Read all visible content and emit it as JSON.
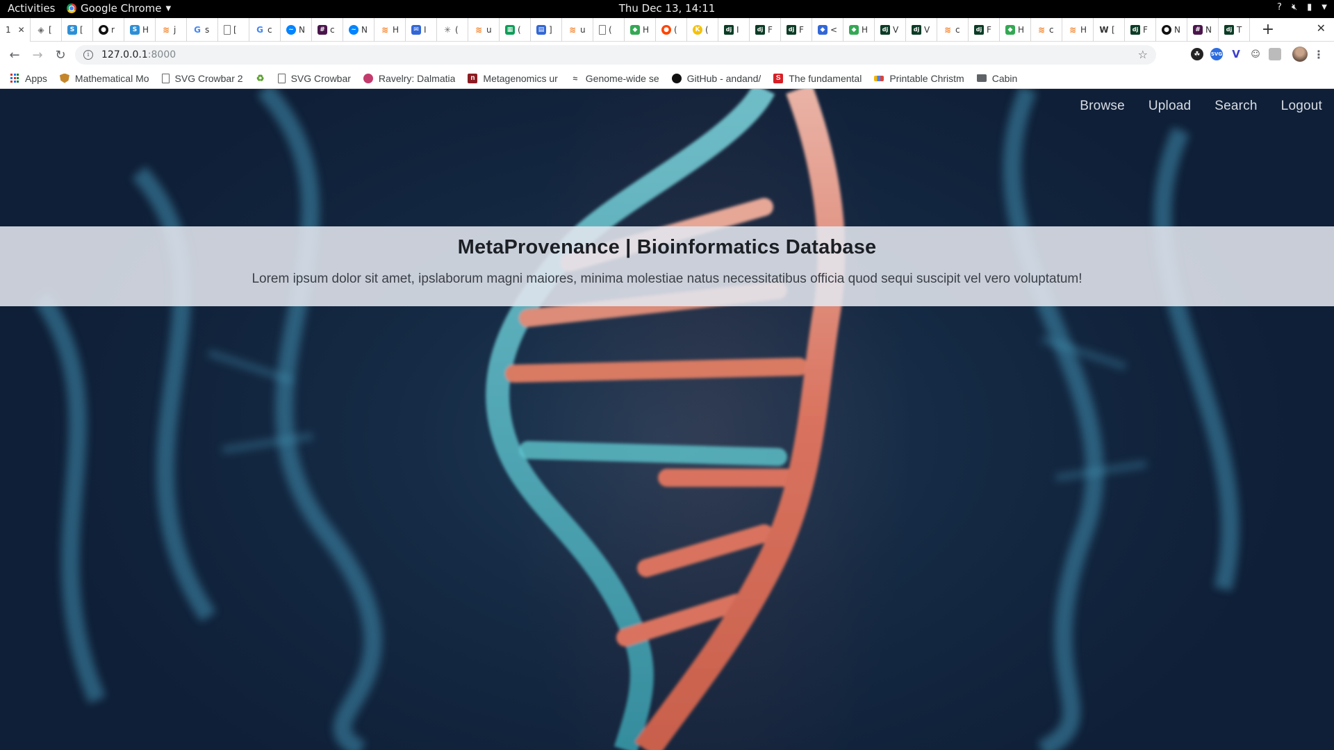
{
  "system_bar": {
    "activities": "Activities",
    "app_name": "Google Chrome",
    "clock": "Thu Dec 13, 14:11"
  },
  "browser": {
    "active_tab_title": "1",
    "tabs": [
      {
        "icon": "compass-icon",
        "letter": "["
      },
      {
        "icon": "scholar-icon",
        "letter": "["
      },
      {
        "icon": "github-icon",
        "letter": "r"
      },
      {
        "icon": "scholar-icon",
        "letter": "H"
      },
      {
        "icon": "stackoverflow-icon",
        "letter": "j"
      },
      {
        "icon": "google-icon",
        "letter": "s"
      },
      {
        "icon": "document-icon",
        "letter": "["
      },
      {
        "icon": "google-icon",
        "letter": "c"
      },
      {
        "icon": "messenger-icon",
        "letter": "N"
      },
      {
        "icon": "slack-icon",
        "letter": "c"
      },
      {
        "icon": "messenger-icon",
        "letter": "N"
      },
      {
        "icon": "stackoverflow-icon",
        "letter": "H"
      },
      {
        "icon": "mail-icon",
        "letter": "I"
      },
      {
        "icon": "asterisk-icon",
        "letter": "("
      },
      {
        "icon": "stackoverflow-icon",
        "letter": "u"
      },
      {
        "icon": "sheets-icon",
        "letter": "("
      },
      {
        "icon": "calendar-icon",
        "letter": "]"
      },
      {
        "icon": "stackoverflow-icon",
        "letter": "u"
      },
      {
        "icon": "document-icon",
        "letter": "("
      },
      {
        "icon": "green-app-icon",
        "letter": "H"
      },
      {
        "icon": "reddit-icon",
        "letter": "("
      },
      {
        "icon": "yellow-app-icon",
        "letter": "("
      },
      {
        "icon": "django-icon",
        "letter": "I"
      },
      {
        "icon": "django-icon",
        "letter": "F"
      },
      {
        "icon": "django-icon",
        "letter": "F"
      },
      {
        "icon": "blue-app-icon",
        "letter": "<"
      },
      {
        "icon": "green-app-icon",
        "letter": "H"
      },
      {
        "icon": "django-icon",
        "letter": "V"
      },
      {
        "icon": "django-icon",
        "letter": "V"
      },
      {
        "icon": "stackoverflow-icon",
        "letter": "c"
      },
      {
        "icon": "django-icon",
        "letter": "F"
      },
      {
        "icon": "green-app-icon",
        "letter": "H"
      },
      {
        "icon": "stackoverflow-icon",
        "letter": "c"
      },
      {
        "icon": "stackoverflow-icon",
        "letter": "H"
      },
      {
        "icon": "wikipedia-icon",
        "letter": "["
      },
      {
        "icon": "django-icon",
        "letter": "F"
      },
      {
        "icon": "github-icon",
        "letter": "N"
      },
      {
        "icon": "slack-icon",
        "letter": "N"
      },
      {
        "icon": "django-icon",
        "letter": "T"
      }
    ],
    "url_host": "127.0.0.1",
    "url_port": ":8000",
    "bookmarks": [
      {
        "label": "Apps",
        "icon": "apps-icon"
      },
      {
        "label": "Mathematical Mo",
        "icon": "shield-icon"
      },
      {
        "label": "SVG Crowbar 2",
        "icon": "document-icon"
      },
      {
        "label": "",
        "icon": "leaf-icon"
      },
      {
        "label": "SVG Crowbar",
        "icon": "document-icon"
      },
      {
        "label": "Ravelry: Dalmatia",
        "icon": "yarn-icon"
      },
      {
        "label": "Metagenomics ur",
        "icon": "metagenomics-icon"
      },
      {
        "label": "Genome-wide se",
        "icon": "genome-icon"
      },
      {
        "label": "GitHub - andand/",
        "icon": "github-icon"
      },
      {
        "label": "The fundamental",
        "icon": "s-logo-icon"
      },
      {
        "label": "Printable Christm",
        "icon": "printable-icon"
      },
      {
        "label": "Cabin",
        "icon": "folder-icon"
      }
    ]
  },
  "site": {
    "nav": [
      "Browse",
      "Upload",
      "Search",
      "Logout"
    ],
    "title": "MetaProvenance | Bioinformatics Database",
    "subtitle": "Lorem ipsum dolor sit amet, ipslaborum magni maiores, minima molestiae natus necessitatibus officia quod sequi suscipit vel vero voluptatum!"
  },
  "colors": {
    "background": "#152a44",
    "helix_red": "#d9735f",
    "helix_cyan": "#5fc7cf",
    "hero_band": "#e2e6ee"
  }
}
